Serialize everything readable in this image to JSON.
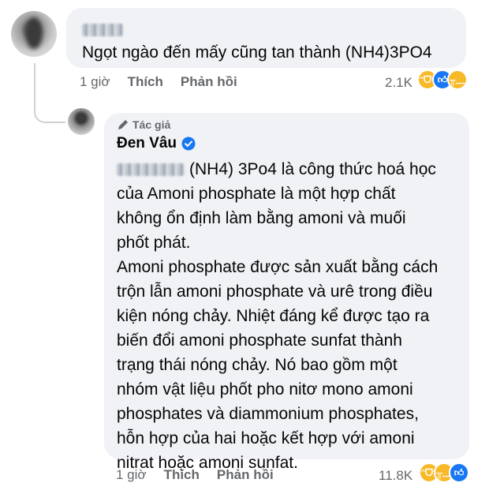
{
  "comment": {
    "text": "Ngọt ngào đến mấy cũng tan thành (NH4)3PO4",
    "time": "1 giờ",
    "like_label": "Thích",
    "reply_label": "Phản hồi",
    "reaction_count": "2.1K",
    "reactions": [
      "haha-icon",
      "like-icon",
      "sad-icon"
    ]
  },
  "reply": {
    "author_tag": "Tác giả",
    "author_name": "Đen Vâu",
    "verified_icon": "verified-badge-icon",
    "lines": [
      "(NH4) 3Po4 là công thức hoá học",
      "của Amoni phosphate là một hợp chất",
      "không ổn định làm bằng amoni và muối",
      "phốt phát.",
      "Amoni phosphate được sản xuất bằng cách",
      "trộn lẫn amoni phosphate và urê trong điều",
      "kiện nóng chảy. Nhiệt đáng kể được tạo ra",
      "biến đổi amoni phosphate sunfat thành",
      "trạng thái nóng chảy. Nó bao gồm một",
      "nhóm vật liệu phốt pho nitơ mono amoni",
      "phosphates và diammonium phosphates,",
      "hỗn hợp của hai hoặc kết hợp với amoni",
      "nitrat hoặc amoni sunfat."
    ],
    "time": "1 giờ",
    "like_label": "Thích",
    "reply_label": "Phản hồi",
    "reaction_count": "11.8K",
    "reactions": [
      "haha-icon",
      "sad-icon",
      "like-icon"
    ]
  },
  "colors": {
    "bubble": "#f0f2f5",
    "meta_text": "#65676b",
    "like_blue": "#1877f2",
    "emoji_yellow": "#f7b928"
  }
}
